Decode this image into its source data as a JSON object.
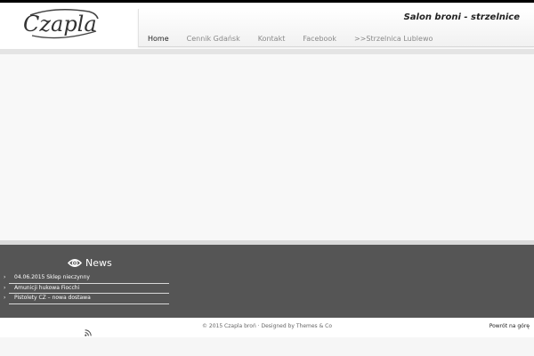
{
  "header": {
    "logo_text": "Czapla",
    "tagline": "Salon broni - strzelnice",
    "nav": [
      {
        "label": "Home",
        "active": true
      },
      {
        "label": "Cennik Gdańsk",
        "active": false
      },
      {
        "label": "Kontakt",
        "active": false
      },
      {
        "label": "Facebook",
        "active": false
      },
      {
        "label": ">>Strzelnica Lublewo",
        "active": false
      }
    ]
  },
  "news": {
    "title": "News",
    "icon": "eye-icon",
    "items": [
      {
        "label": "04.06.2015 Sklep nieczynny"
      },
      {
        "label": "Amunicji hukowa Fiocchi"
      },
      {
        "label": "Pistolety CZ – nowa dostawa"
      }
    ]
  },
  "footer": {
    "rss_icon": "rss-icon",
    "copyright": "© 2015 Czapla broń · Designed by Themes & Co",
    "back_to_top": "Powrót na górę"
  },
  "colors": {
    "topbar": "#000000",
    "footer_widgets_bg": "#555555",
    "content_bg": "#f8f8f8",
    "nav_text": "#8a8a8a",
    "nav_active_text": "#222222"
  }
}
